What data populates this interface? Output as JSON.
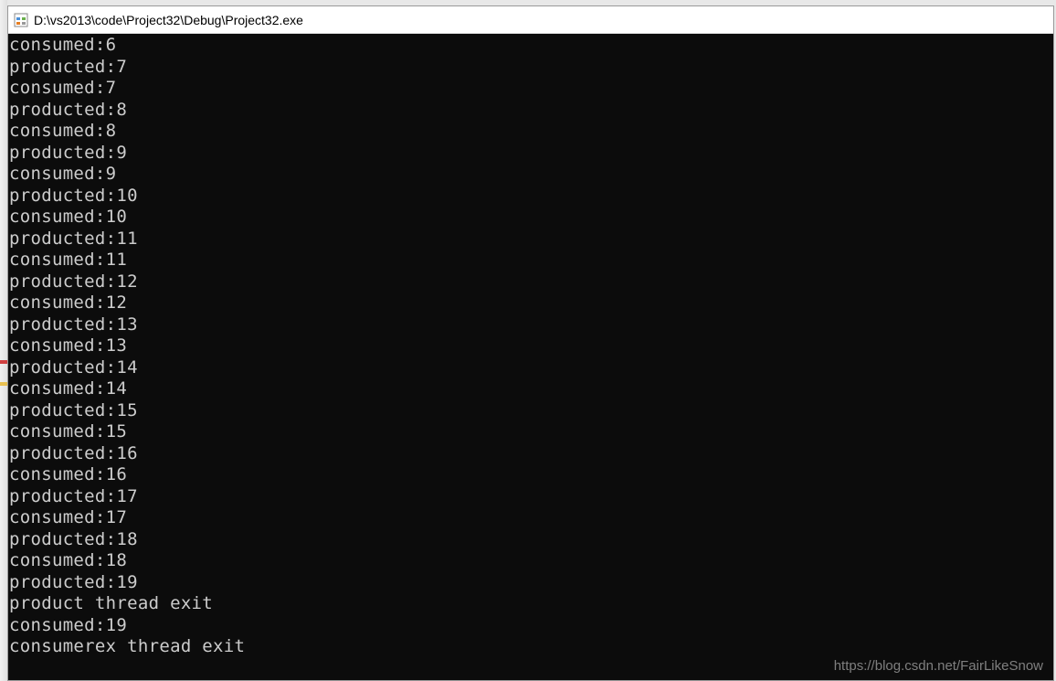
{
  "window": {
    "title_path": "D:\\vs2013\\code\\Project32\\Debug\\Project32.exe"
  },
  "console": {
    "lines": [
      "consumed:6",
      "producted:7",
      "consumed:7",
      "producted:8",
      "consumed:8",
      "producted:9",
      "consumed:9",
      "producted:10",
      "consumed:10",
      "producted:11",
      "consumed:11",
      "producted:12",
      "consumed:12",
      "producted:13",
      "consumed:13",
      "producted:14",
      "consumed:14",
      "producted:15",
      "consumed:15",
      "producted:16",
      "consumed:16",
      "producted:17",
      "consumed:17",
      "producted:18",
      "consumed:18",
      "producted:19",
      "product thread exit",
      "consumed:19",
      "consumerex thread exit"
    ]
  },
  "watermark": {
    "text": "https://blog.csdn.net/FairLikeSnow"
  }
}
